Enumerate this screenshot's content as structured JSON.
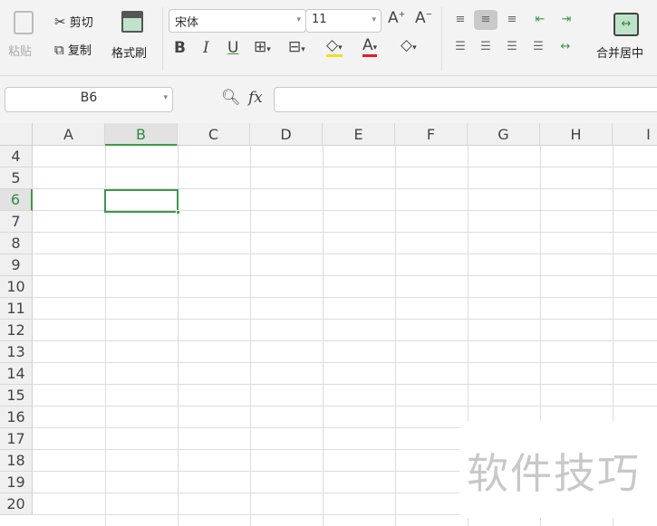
{
  "ribbon": {
    "paste": "粘贴",
    "cut": "剪切",
    "copy": "复制",
    "format_painter": "格式刷",
    "font_name": "宋体",
    "font_size": "11",
    "bold": "B",
    "italic": "I",
    "underline": "U",
    "merge_center": "合并居中"
  },
  "formula_bar": {
    "name_box": "B6",
    "fx": "fx",
    "formula": ""
  },
  "columns": [
    "A",
    "B",
    "C",
    "D",
    "E",
    "F",
    "G",
    "H",
    "I"
  ],
  "rows": [
    "4",
    "5",
    "6",
    "7",
    "8",
    "9",
    "10",
    "11",
    "12",
    "13",
    "14",
    "15",
    "16",
    "17",
    "18",
    "19",
    "20"
  ],
  "selected_cell": "B6",
  "watermark": "软件技巧",
  "colors": {
    "accent": "#2e8b3e",
    "selection": "#3c9a4a"
  }
}
